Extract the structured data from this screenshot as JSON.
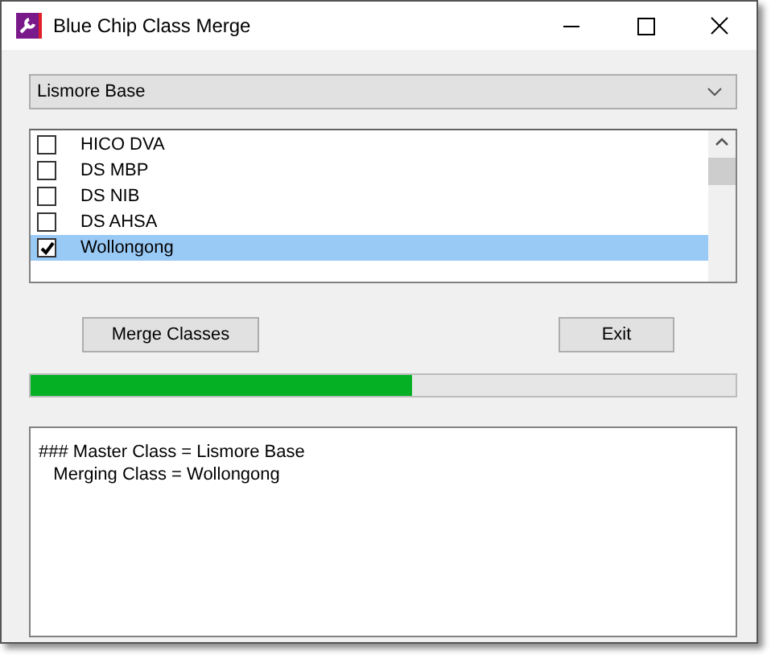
{
  "window": {
    "title": "Blue Chip Class Merge"
  },
  "combo": {
    "value": "Lismore Base"
  },
  "classes": [
    {
      "label": "HICO DVA",
      "checked": false,
      "selected": false
    },
    {
      "label": "DS MBP",
      "checked": false,
      "selected": false
    },
    {
      "label": "DS NIB",
      "checked": false,
      "selected": false
    },
    {
      "label": "DS AHSA",
      "checked": false,
      "selected": false
    },
    {
      "label": "Wollongong",
      "checked": true,
      "selected": true
    }
  ],
  "buttons": [
    "Merge Classes",
    "Exit"
  ],
  "progress": {
    "level": 0.54
  },
  "log": [
    "### Master Class = Lismore Base",
    "   Merging Class = Wollongong"
  ]
}
